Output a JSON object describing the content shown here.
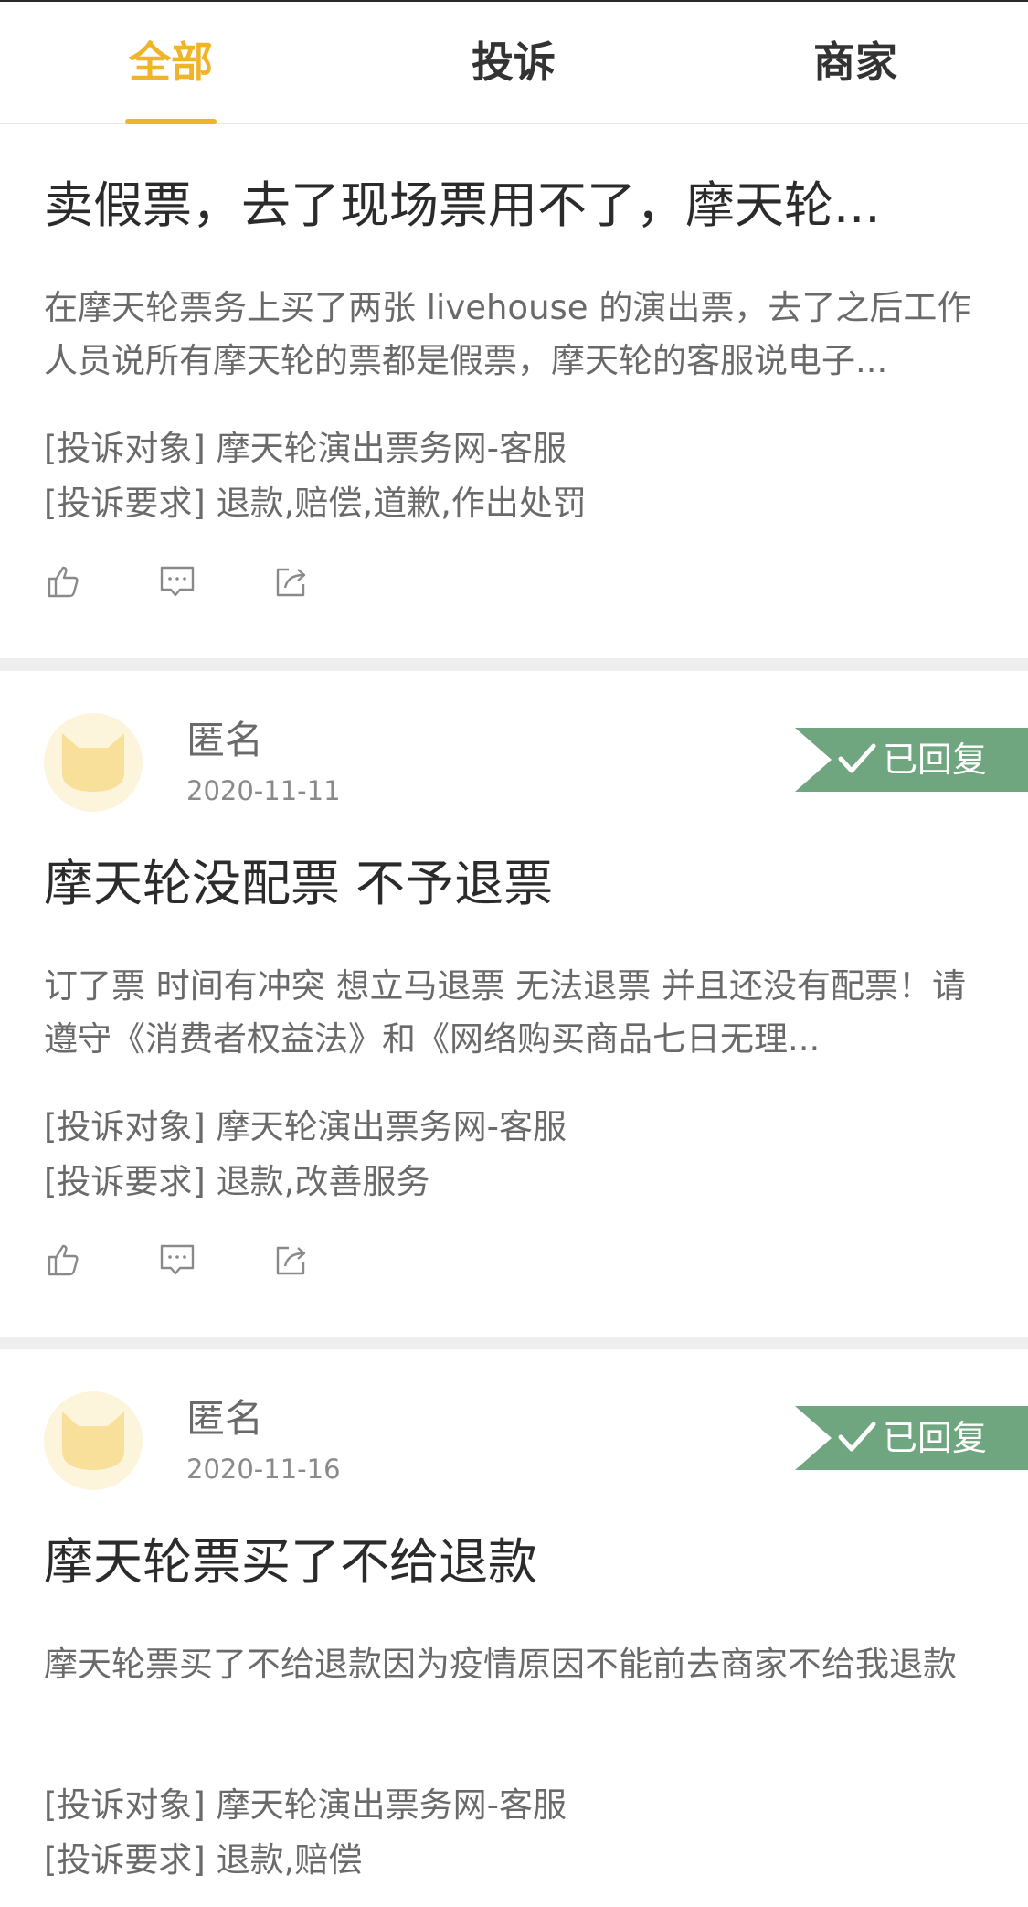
{
  "tabs": [
    {
      "label": "全部"
    },
    {
      "label": "投诉"
    },
    {
      "label": "商家"
    }
  ],
  "colors": {
    "accent": "#f0b429",
    "badge": "#6fa57f"
  },
  "posts": [
    {
      "title": "卖假票，去了现场票用不了，摩天轮...",
      "desc": "在摩天轮票务上买了两张 livehouse 的演出票，去了之后工作人员说所有摩天轮的票都是假票，摩天轮的客服说电子...",
      "target": "[投诉对象] 摩天轮演出票务网-客服",
      "demand": "[投诉要求] 退款,赔偿,道歉,作出处罚"
    },
    {
      "user": "匿名",
      "date": "2020-11-11",
      "status": "已回复",
      "title": "摩天轮没配票 不予退票",
      "desc": "订了票 时间有冲突 想立马退票 无法退票 并且还没有配票！请遵守《消费者权益法》和《网络购买商品七日无理...",
      "target": "[投诉对象] 摩天轮演出票务网-客服",
      "demand": "[投诉要求] 退款,改善服务"
    },
    {
      "user": "匿名",
      "date": "2020-11-16",
      "status": "已回复",
      "title": "摩天轮票买了不给退款",
      "desc": "摩天轮票买了不给退款因为疫情原因不能前去商家不给我退款",
      "target": "[投诉对象] 摩天轮演出票务网-客服",
      "demand": "[投诉要求] 退款,赔偿"
    }
  ]
}
